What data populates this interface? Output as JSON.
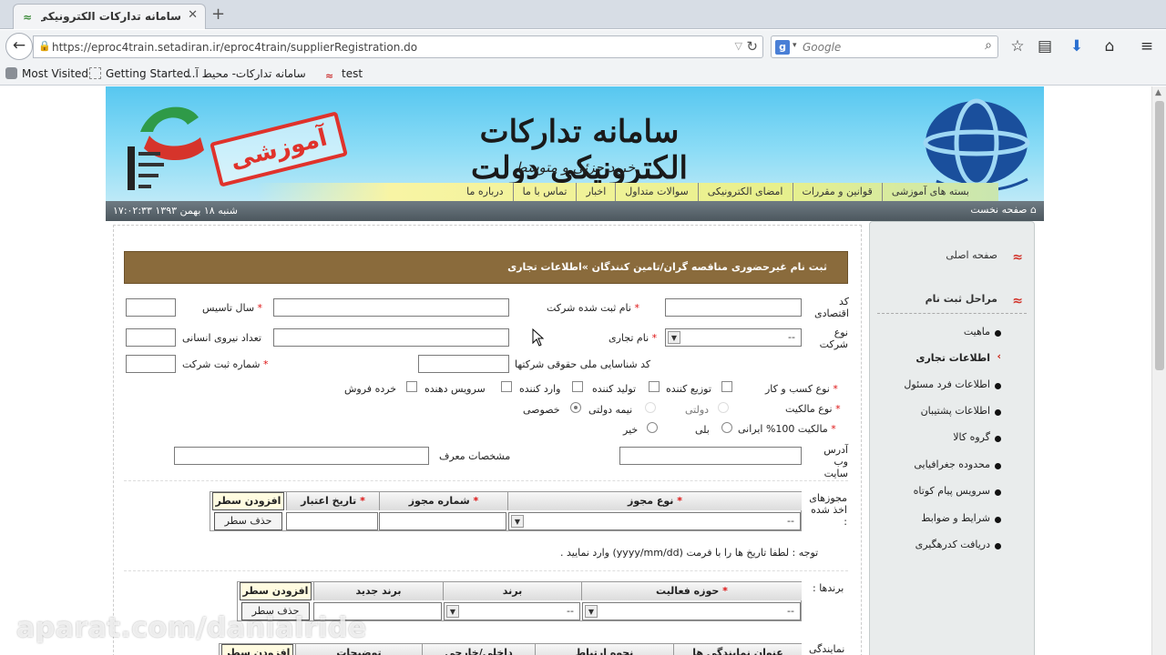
{
  "browser": {
    "tab_title": "سامانه تدارکات الکترونیکی دولت",
    "url": "https://eproc4train.setadiran.ir/eproc4train/supplierRegistration.do",
    "search_placeholder": "Google",
    "bookmarks": [
      "Most Visited",
      "Getting Started",
      "سامانه تدارکات- محیط آ...",
      "test"
    ]
  },
  "banner": {
    "title": "سامانه تدارکات الکترونیکی دولت",
    "subtitle": "خرید جزئی و متوسط",
    "stamp": "آموزشی",
    "menu": [
      "بسته های آموزشی",
      "قوانین و مقررات",
      "امضای الکترونیکی",
      "سوالات متداول",
      "اخبار",
      "تماس با ما",
      "درباره ما"
    ],
    "home_link": "صفحه نخست",
    "datetime": "شنبه ۱۸ بهمن ۱۳۹۳   ۱۷:۰۲:۳۳"
  },
  "form": {
    "section_title": "ثبت نام غیرحضوری مناقصه گران/تامین کنندگان »اطلاعات تجاری",
    "labels": {
      "economic_code": "کد اقتصادی",
      "company_reg_name": "نام ثبت شده شرکت",
      "founding_year": "سال تاسیس",
      "company_type": "نوع شرکت",
      "trade_name": "نام تجاری",
      "staff_count": "تعداد نیروی انسانی",
      "national_id": "کد شناسایی ملی حقوقی شرکتها",
      "reg_number": "شماره ثبت شرکت",
      "business_type": "نوع کسب و کار",
      "ownership_type": "نوع مالکیت",
      "iranian_ownership": "مالکیت 100% ایرانی",
      "website": "آدرس وب سایت",
      "introducer": "مشخصات معرف",
      "licenses": "مجوزهای اخذ شده :",
      "brands": "برندها :",
      "agencies": "نمایندگی"
    },
    "company_type_value": "--",
    "business_types": [
      "توزیع کننده",
      "تولید کننده",
      "وارد کننده",
      "سرویس دهنده",
      "خرده فروش"
    ],
    "ownership_options": [
      "دولتی",
      "نیمه دولتی",
      "خصوصی"
    ],
    "iranian_options": [
      "بلی",
      "خیر"
    ],
    "license_table": {
      "headers": [
        "نوع مجوز",
        "شماره مجوز",
        "تاریخ اعتبار"
      ],
      "add": "افزودن سطر",
      "remove": "حذف سطر",
      "select_value": "--"
    },
    "date_note": "توجه : لطفا تاریخ ها را با فرمت (yyyy/mm/dd) وارد نمایید .",
    "brand_table": {
      "headers": [
        "حوزه فعالیت",
        "برند",
        "برند جدید"
      ],
      "add": "افزودن سطر",
      "remove": "حذف سطر",
      "select_value": "--"
    },
    "agency_table": {
      "headers": [
        "عنوان نمایندگی ها",
        "نحوه ارتباط",
        "داخلی/خارجی",
        "توضیحات"
      ],
      "add": "افزودن سطر"
    }
  },
  "sidebar": {
    "home": "صفحه اصلی",
    "steps_title": "مراحل ثبت نام",
    "items": [
      "ماهیت",
      "اطلاعات تجاری",
      "اطلاعات فرد مسئول",
      "اطلاعات پشتیبان",
      "گروه کالا",
      "محدوده جغرافیایی",
      "سرویس پیام کوتاه",
      "شرایط و ضوابط",
      "دریافت کدرهگیری"
    ]
  },
  "watermark": "aparat.com/danialride"
}
